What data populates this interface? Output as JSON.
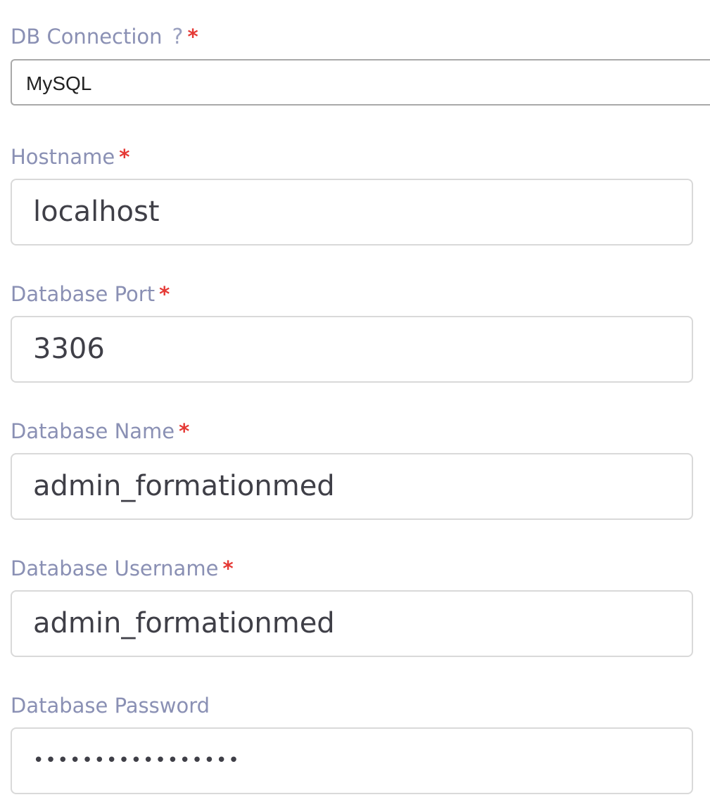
{
  "db_connection": {
    "label": "DB Connection",
    "help_icon": "?",
    "required_mark": "*",
    "selected": "MySQL"
  },
  "hostname": {
    "label": "Hostname",
    "required_mark": "*",
    "value": "localhost"
  },
  "port": {
    "label": "Database Port",
    "required_mark": "*",
    "value": "3306"
  },
  "db_name": {
    "label": "Database Name",
    "required_mark": "*",
    "value": "admin_formationmed"
  },
  "db_username": {
    "label": "Database Username",
    "required_mark": "*",
    "value": "admin_formationmed"
  },
  "db_password": {
    "label": "Database Password",
    "value": "•••••••••••••••••"
  },
  "colors": {
    "label": "#8a90b4",
    "required": "#e53935",
    "input_text": "#3f3f47",
    "input_border": "#d9d9d9"
  }
}
